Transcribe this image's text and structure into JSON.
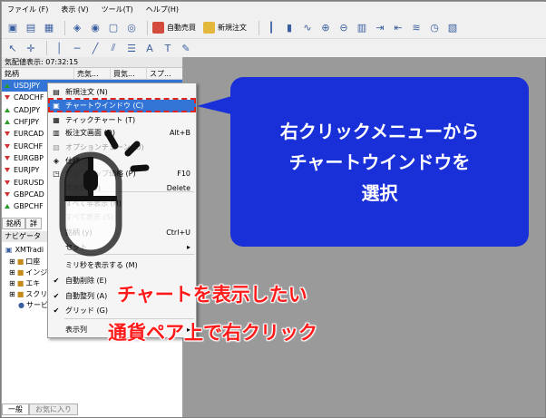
{
  "menu": [
    "ファイル (F)",
    "表示 (V)",
    "ツール(T)",
    "ヘルプ(H)"
  ],
  "toolbar": {
    "auto_trade": "自動売買",
    "new_order": "新規注文"
  },
  "market_watch": {
    "title": "気配値表示: 07:32:15",
    "columns": [
      "銘柄",
      "売気...",
      "買気...",
      "スプ..."
    ],
    "symbols": [
      {
        "name": "USDJPY",
        "dir": "up"
      },
      {
        "name": "CADCHF",
        "dir": "dn"
      },
      {
        "name": "CADJPY",
        "dir": "up"
      },
      {
        "name": "CHFJPY",
        "dir": "up"
      },
      {
        "name": "EURCAD",
        "dir": "dn"
      },
      {
        "name": "EURCHF",
        "dir": "dn"
      },
      {
        "name": "EURGBP",
        "dir": "dn"
      },
      {
        "name": "EURJPY",
        "dir": "dn"
      },
      {
        "name": "EURUSD",
        "dir": "dn"
      },
      {
        "name": "GBPCAD",
        "dir": "dn"
      },
      {
        "name": "GBPCHF",
        "dir": "up"
      }
    ],
    "tabs": [
      "銘柄",
      "詳"
    ]
  },
  "navigator": {
    "title": "ナビゲータ",
    "items": [
      "XMTradi",
      "口座",
      "インジ",
      "エキ",
      "スクリ",
      "サービ"
    ],
    "tabs": [
      "一般",
      "お気に入り"
    ]
  },
  "context_menu": {
    "items": [
      {
        "label": "新規注文 (N)",
        "shortcut": "",
        "state": "normal"
      },
      {
        "label": "チャートウインドウ (C)",
        "shortcut": "",
        "state": "highlight"
      },
      {
        "label": "ティックチャート (T)",
        "shortcut": "",
        "state": "normal"
      },
      {
        "label": "板注文画面 (D)",
        "shortcut": "Alt+B",
        "state": "normal"
      },
      {
        "label": "オプションチェーン (O)",
        "shortcut": "",
        "state": "disabled"
      },
      {
        "label": "仕様 (P)",
        "shortcut": "",
        "state": "normal"
      },
      {
        "label": "ポップアップ価格 (P)",
        "shortcut": "F10",
        "state": "normal"
      },
      {
        "label": "非表示 (D)",
        "shortcut": "Delete",
        "state": "normal"
      },
      {
        "label": "すべて非表示 (H)",
        "shortcut": "",
        "state": "normal"
      },
      {
        "label": "すべて表示 (S)",
        "shortcut": "",
        "state": "disabled"
      },
      {
        "label": "銘柄 (y)",
        "shortcut": "Ctrl+U",
        "state": "normal"
      },
      {
        "label": "セット",
        "shortcut": "▸",
        "state": "normal"
      },
      {
        "label": "ミリ秒を表示する (M)",
        "shortcut": "",
        "state": "normal"
      },
      {
        "label": "自動削除 (E)",
        "shortcut": "",
        "state": "checked"
      },
      {
        "label": "自動整列 (A)",
        "shortcut": "",
        "state": "checked"
      },
      {
        "label": "グリッド (G)",
        "shortcut": "",
        "state": "checked"
      },
      {
        "label": "表示列",
        "shortcut": "▸",
        "state": "normal"
      }
    ]
  },
  "callout": {
    "line1": "右クリックメニューから",
    "line2": "チャートウインドウを",
    "line3": "選択"
  },
  "annotation": {
    "line1": "チャートを表示したい",
    "line2": "通貨ペア上で右クリック"
  },
  "colors": {
    "callout_bg": "#1930d8",
    "highlight": "#3375d6",
    "annotation_red": "#ff1a1a"
  }
}
